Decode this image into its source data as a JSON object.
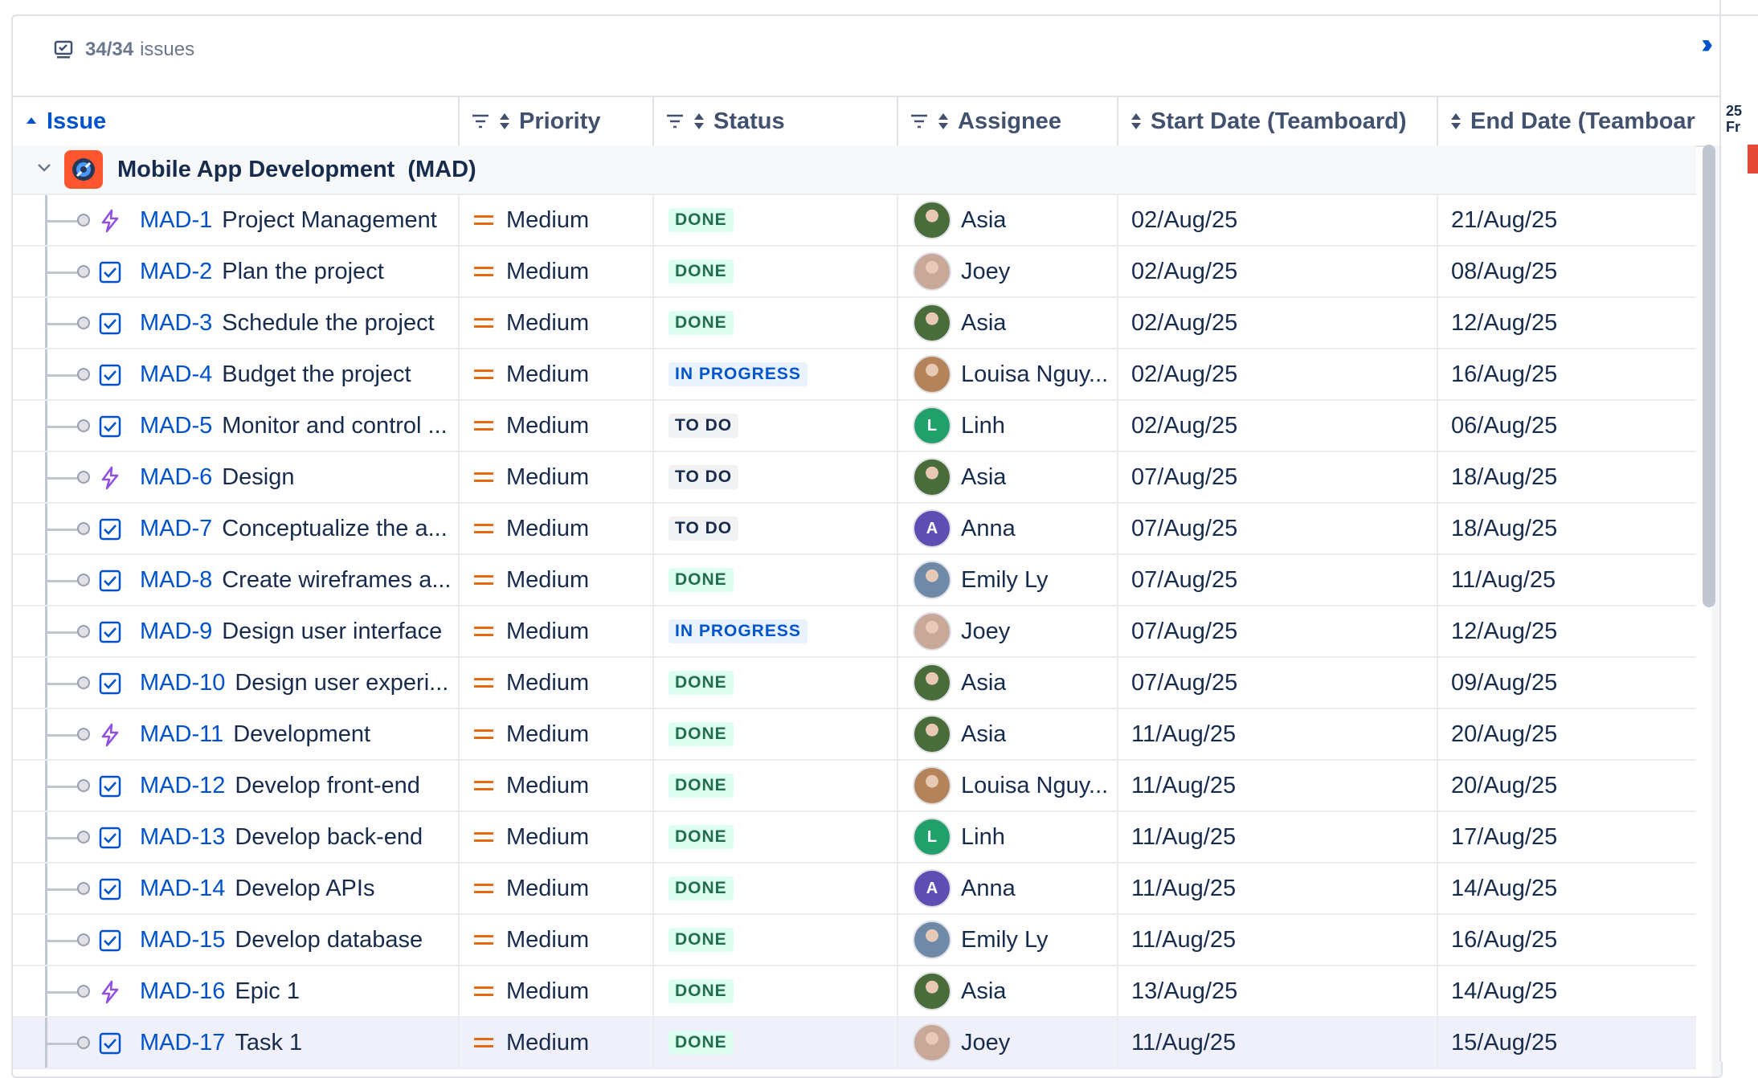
{
  "toolbar": {
    "count_label": "34/34",
    "count_suffix": "issues"
  },
  "columns": {
    "issue": "Issue",
    "priority": "Priority",
    "status": "Status",
    "assignee": "Assignee",
    "start": "Start Date (Teamboard)",
    "end": "End Date (Teamboard)"
  },
  "group": {
    "name": "Mobile App Development",
    "key": "(MAD)"
  },
  "gantt": {
    "day": "25",
    "weekday": "Fr"
  },
  "colors": {
    "link": "#0052cc",
    "epic": "#904ee2",
    "priority_medium": "#e56910",
    "project_icon": "#ff5630"
  },
  "rows": [
    {
      "key": "MAD-1",
      "summary": "Project Management",
      "type": "epic-icon",
      "priority": "Medium",
      "status": "DONE",
      "assignee": "Asia",
      "avatar": "photo",
      "start": "02/Aug/25",
      "end": "21/Aug/25"
    },
    {
      "key": "MAD-2",
      "summary": "Plan the project",
      "type": "task-icon",
      "priority": "Medium",
      "status": "DONE",
      "assignee": "Joey",
      "avatar": "photo",
      "start": "02/Aug/25",
      "end": "08/Aug/25"
    },
    {
      "key": "MAD-3",
      "summary": "Schedule the project",
      "type": "task-icon",
      "priority": "Medium",
      "status": "DONE",
      "assignee": "Asia",
      "avatar": "photo",
      "start": "02/Aug/25",
      "end": "12/Aug/25"
    },
    {
      "key": "MAD-4",
      "summary": "Budget the project",
      "type": "task-icon",
      "priority": "Medium",
      "status": "IN PROGRESS",
      "assignee": "Louisa Nguy...",
      "avatar": "photo",
      "start": "02/Aug/25",
      "end": "16/Aug/25"
    },
    {
      "key": "MAD-5",
      "summary": "Monitor and control ...",
      "type": "task-icon",
      "priority": "Medium",
      "status": "TO DO",
      "assignee": "Linh",
      "avatar": "L",
      "start": "02/Aug/25",
      "end": "06/Aug/25"
    },
    {
      "key": "MAD-6",
      "summary": "Design",
      "type": "epic-icon",
      "priority": "Medium",
      "status": "TO DO",
      "assignee": "Asia",
      "avatar": "photo",
      "start": "07/Aug/25",
      "end": "18/Aug/25"
    },
    {
      "key": "MAD-7",
      "summary": "Conceptualize the a...",
      "type": "task-icon",
      "priority": "Medium",
      "status": "TO DO",
      "assignee": "Anna",
      "avatar": "A",
      "start": "07/Aug/25",
      "end": "18/Aug/25"
    },
    {
      "key": "MAD-8",
      "summary": "Create wireframes a...",
      "type": "task-icon",
      "priority": "Medium",
      "status": "DONE",
      "assignee": "Emily Ly",
      "avatar": "photo",
      "start": "07/Aug/25",
      "end": "11/Aug/25"
    },
    {
      "key": "MAD-9",
      "summary": "Design user interface",
      "type": "task-icon",
      "priority": "Medium",
      "status": "IN PROGRESS",
      "assignee": "Joey",
      "avatar": "photo",
      "start": "07/Aug/25",
      "end": "12/Aug/25"
    },
    {
      "key": "MAD-10",
      "summary": "Design user experi...",
      "type": "task-icon",
      "priority": "Medium",
      "status": "DONE",
      "assignee": "Asia",
      "avatar": "photo",
      "start": "07/Aug/25",
      "end": "09/Aug/25"
    },
    {
      "key": "MAD-11",
      "summary": "Development",
      "type": "epic-icon",
      "priority": "Medium",
      "status": "DONE",
      "assignee": "Asia",
      "avatar": "photo",
      "start": "11/Aug/25",
      "end": "20/Aug/25"
    },
    {
      "key": "MAD-12",
      "summary": "Develop front-end",
      "type": "task-icon",
      "priority": "Medium",
      "status": "DONE",
      "assignee": "Louisa Nguy...",
      "avatar": "photo",
      "start": "11/Aug/25",
      "end": "20/Aug/25"
    },
    {
      "key": "MAD-13",
      "summary": "Develop back-end",
      "type": "task-icon",
      "priority": "Medium",
      "status": "DONE",
      "assignee": "Linh",
      "avatar": "L",
      "start": "11/Aug/25",
      "end": "17/Aug/25"
    },
    {
      "key": "MAD-14",
      "summary": "Develop APIs",
      "type": "task-icon",
      "priority": "Medium",
      "status": "DONE",
      "assignee": "Anna",
      "avatar": "A",
      "start": "11/Aug/25",
      "end": "14/Aug/25"
    },
    {
      "key": "MAD-15",
      "summary": "Develop database",
      "type": "task-icon",
      "priority": "Medium",
      "status": "DONE",
      "assignee": "Emily Ly",
      "avatar": "photo",
      "start": "11/Aug/25",
      "end": "16/Aug/25"
    },
    {
      "key": "MAD-16",
      "summary": "Epic 1",
      "type": "epic-icon",
      "priority": "Medium",
      "status": "DONE",
      "assignee": "Asia",
      "avatar": "photo",
      "start": "13/Aug/25",
      "end": "14/Aug/25"
    },
    {
      "key": "MAD-17",
      "summary": "Task 1",
      "type": "task-icon",
      "priority": "Medium",
      "status": "DONE",
      "assignee": "Joey",
      "avatar": "photo",
      "start": "11/Aug/25",
      "end": "15/Aug/25",
      "selected": true
    }
  ]
}
